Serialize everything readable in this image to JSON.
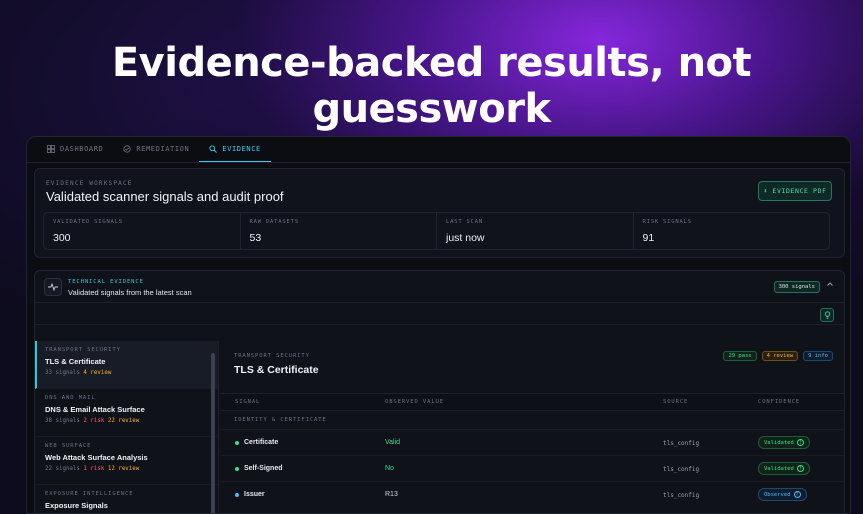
{
  "headline": "Evidence-backed results, not guesswork",
  "tabs": [
    {
      "label": "DASHBOARD",
      "icon": "grid-icon"
    },
    {
      "label": "REMEDIATION",
      "icon": "shield-icon"
    },
    {
      "label": "EVIDENCE",
      "icon": "search-icon",
      "active": true
    }
  ],
  "workspace": {
    "kicker": "EVIDENCE WORKSPACE",
    "title": "Validated scanner signals and audit proof",
    "pdf_button": "⬇ EVIDENCE PDF",
    "stats": [
      {
        "label": "VALIDATED SIGNALS",
        "value": "300"
      },
      {
        "label": "RAW DATASETS",
        "value": "53"
      },
      {
        "label": "LAST SCAN",
        "value": "just now"
      },
      {
        "label": "RISK SIGNALS",
        "value": "91"
      }
    ]
  },
  "technical": {
    "kicker": "TECHNICAL EVIDENCE",
    "subtitle": "Validated signals from the latest scan",
    "count_badge": "300 signals"
  },
  "nav": [
    {
      "kicker": "TRANSPORT SECURITY",
      "title": "TLS & Certificate",
      "signals": "33 signals",
      "risk": "",
      "review": "4 review",
      "active": true
    },
    {
      "kicker": "DNS AND MAIL",
      "title": "DNS & Email Attack Surface",
      "signals": "38 signals",
      "risk": "2 risk",
      "review": "22 review"
    },
    {
      "kicker": "WEB SURFACE",
      "title": "Web Attack Surface Analysis",
      "signals": "22 signals",
      "risk": "1 risk",
      "review": "12 review"
    },
    {
      "kicker": "EXPOSURE INTELLIGENCE",
      "title": "Exposure Signals",
      "signals": "",
      "risk": "",
      "review": ""
    }
  ],
  "detail": {
    "kicker": "TRANSPORT SECURITY",
    "title": "TLS & Certificate",
    "pills": {
      "pass": "29 pass",
      "review": "4 review",
      "info": "9 info"
    },
    "columns": {
      "signal": "SIGNAL",
      "observed": "OBSERVED VALUE",
      "source": "SOURCE",
      "confidence": "CONFIDENCE"
    },
    "group": "IDENTITY & CERTIFICATE",
    "rows": [
      {
        "signal": "Certificate",
        "observed": "Valid",
        "source": "tls_config",
        "confidence": "Validated",
        "dot_color": "#3ee08a"
      },
      {
        "signal": "Self-Signed",
        "observed": "No",
        "source": "tls_config",
        "confidence": "Validated",
        "dot_color": "#3ee08a"
      },
      {
        "signal": "Issuer",
        "observed": "R13",
        "source": "tls_config",
        "confidence": "Observed",
        "dot_color": "#57b4ff"
      }
    ]
  },
  "colors": {
    "accent": "#36c7dc",
    "pass": "#3ee08a",
    "review": "#ffb020",
    "risk": "#ff5d6c",
    "info": "#57b4ff"
  }
}
